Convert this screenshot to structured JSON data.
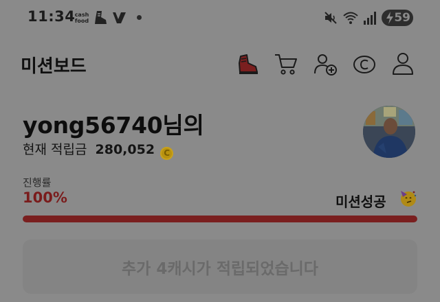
{
  "status_bar": {
    "time": "11:34",
    "cash_label": "cash",
    "food_label": "food",
    "battery": "59"
  },
  "header": {
    "title": "미션보드",
    "icons": [
      "boot-icon",
      "cart-icon",
      "add-friend-icon",
      "coin-icon",
      "profile-icon"
    ]
  },
  "user": {
    "name": "yong56740님의",
    "balance_label": "현재 적립금",
    "balance_value": "280,052",
    "coin_symbol": "C"
  },
  "progress": {
    "label": "진행률",
    "value_text": "100%",
    "fraction": 1.0,
    "status": "미션성공"
  },
  "reward": {
    "text": "추가 4캐시가 적립되었습니다"
  },
  "colors": {
    "accent_red": "#7a1f1f",
    "overlay_gray": "#8a8a8a"
  }
}
